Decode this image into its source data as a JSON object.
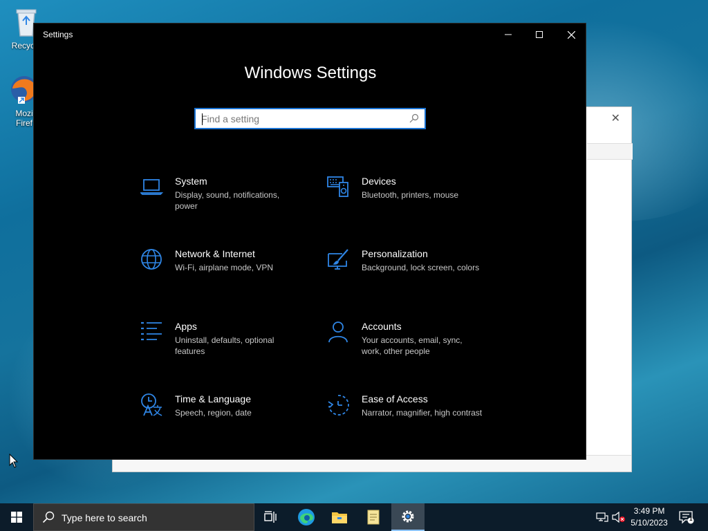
{
  "desktop": {
    "icons": [
      {
        "label": "Recycle",
        "icon": "recycle-bin-icon"
      },
      {
        "label": "Mozi",
        "label2": "Firef",
        "icon": "firefox-icon"
      }
    ]
  },
  "settings": {
    "window_title": "Settings",
    "heading": "Windows Settings",
    "search_placeholder": "Find a setting",
    "tiles": [
      {
        "name": "System",
        "desc": "Display, sound, notifications, power",
        "icon": "laptop-icon"
      },
      {
        "name": "Devices",
        "desc": "Bluetooth, printers, mouse",
        "icon": "devices-icon"
      },
      {
        "name": "Network & Internet",
        "desc": "Wi-Fi, airplane mode, VPN",
        "icon": "globe-icon"
      },
      {
        "name": "Personalization",
        "desc": "Background, lock screen, colors",
        "icon": "paintbrush-icon"
      },
      {
        "name": "Apps",
        "desc": "Uninstall, defaults, optional features",
        "icon": "apps-list-icon"
      },
      {
        "name": "Accounts",
        "desc": "Your accounts, email, sync, work, other people",
        "icon": "person-icon"
      },
      {
        "name": "Time & Language",
        "desc": "Speech, region, date",
        "icon": "time-language-icon"
      },
      {
        "name": "Ease of Access",
        "desc": "Narrator, magnifier, high contrast",
        "icon": "ease-of-access-icon"
      }
    ]
  },
  "taskbar": {
    "search_placeholder": "Type here to search",
    "apps": [
      "task-view-icon",
      "edge-icon",
      "file-explorer-icon",
      "notepad-icon",
      "settings-gear-icon"
    ],
    "clock_time": "3:49 PM",
    "clock_date": "5/10/2023",
    "notification_count": "1"
  },
  "colors": {
    "accent": "#1a73d4",
    "icon_blue": "#2f86e6",
    "taskbar": "#0c1c2a"
  }
}
